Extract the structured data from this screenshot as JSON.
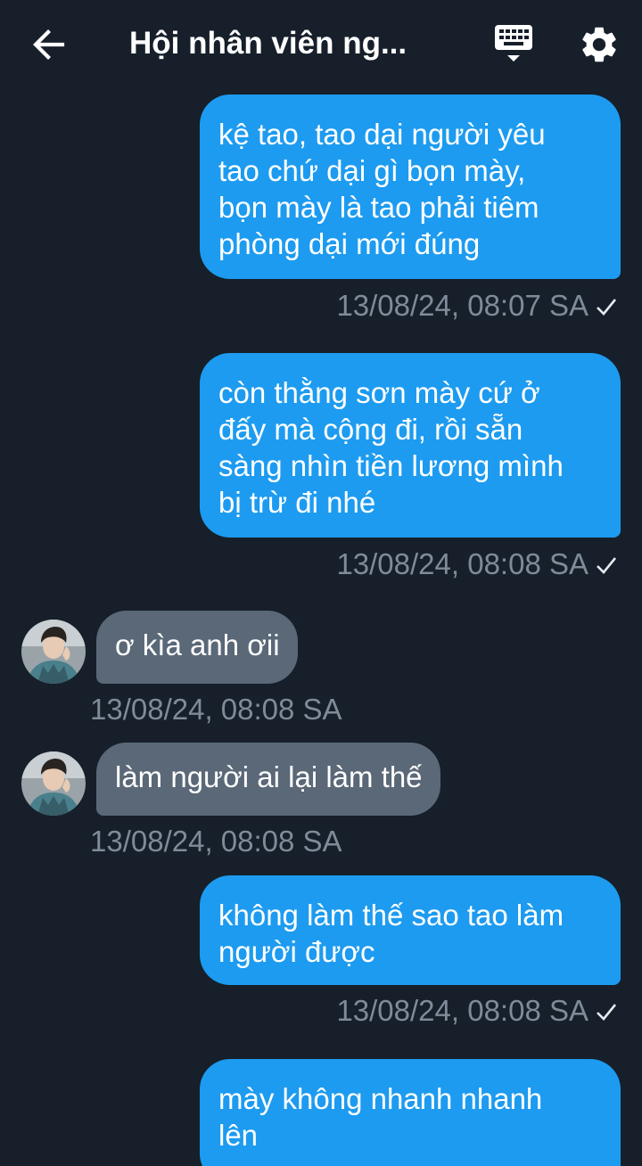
{
  "header": {
    "title": "Hội nhân viên ng...",
    "back_icon": "arrow-left-icon",
    "keyboard_icon": "keyboard-icon",
    "settings_icon": "gear-icon"
  },
  "colors": {
    "background": "#161f2a",
    "outgoing_bubble": "#1d9bf0",
    "incoming_bubble": "#5a6878",
    "timestamp": "#7f8b98"
  },
  "messages": [
    {
      "direction": "outgoing",
      "lines": [
        "kệ tao, tao dại người yêu",
        "tao chứ dại gì bọn mày,",
        "bọn mày là tao phải tiêm",
        "phòng dại mới đúng"
      ],
      "time": "13/08/24, 08:07 SA"
    },
    {
      "direction": "outgoing",
      "lines": [
        "còn thằng sơn mày cứ ở",
        "đấy mà cộng đi, rồi sẵn",
        "sàng nhìn tiền lương mình",
        "bị trừ đi nhé"
      ],
      "time": "13/08/24, 08:08 SA"
    },
    {
      "direction": "incoming",
      "lines": [
        "ơ kìa anh ơii"
      ],
      "time": "13/08/24, 08:08 SA"
    },
    {
      "direction": "incoming",
      "lines": [
        "làm người ai lại làm thế"
      ],
      "time": "13/08/24, 08:08 SA"
    },
    {
      "direction": "outgoing",
      "lines": [
        "không làm thế sao tao làm",
        "người được"
      ],
      "time": "13/08/24, 08:08 SA"
    },
    {
      "direction": "outgoing",
      "lines": [
        "mày không nhanh nhanh",
        "lên"
      ],
      "time": ""
    }
  ]
}
